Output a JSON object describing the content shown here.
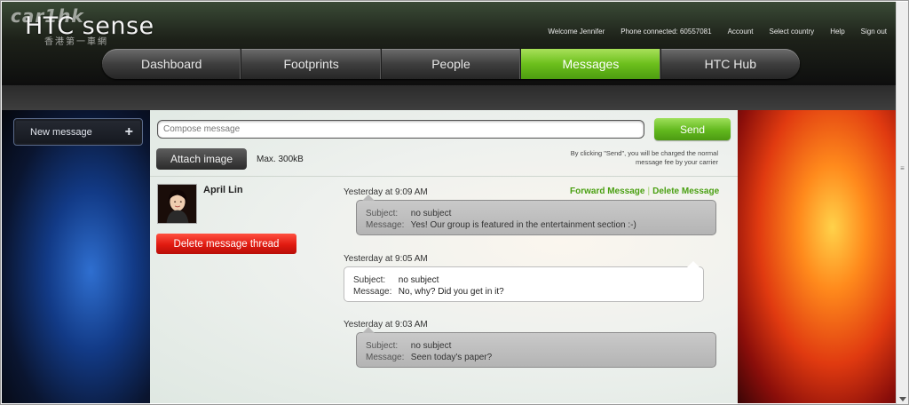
{
  "header": {
    "logo": "HTC sense",
    "watermark": "car1hk",
    "watermark_sub": "香港第一車網",
    "links": {
      "welcome": "Welcome Jennifer",
      "phone": "Phone connected: 60557081",
      "account": "Account",
      "country": "Select country",
      "help": "Help",
      "signout": "Sign out"
    }
  },
  "nav": {
    "tabs": [
      {
        "label": "Dashboard"
      },
      {
        "label": "Footprints"
      },
      {
        "label": "People"
      },
      {
        "label": "Messages"
      },
      {
        "label": "HTC Hub"
      }
    ],
    "active": "Messages"
  },
  "sidebar": {
    "new_message_label": "New message",
    "new_message_icon": "+"
  },
  "compose": {
    "placeholder": "Compose message",
    "send_label": "Send",
    "attach_label": "Attach image",
    "max_size": "Max. 300kB",
    "disclaimer": "By clicking \"Send\", you will be charged the normal message fee by your carrier"
  },
  "contact": {
    "name": "April Lin",
    "delete_thread_label": "Delete message thread"
  },
  "message_actions": {
    "forward": "Forward Message",
    "separator": "|",
    "delete": "Delete Message"
  },
  "labels": {
    "subject": "Subject:",
    "message": "Message:"
  },
  "messages": [
    {
      "time": "Yesterday at 9:09 AM",
      "direction": "in",
      "subject": "no subject",
      "body": "Yes! Our group is featured in the entertainment section :-)"
    },
    {
      "time": "Yesterday at 9:05 AM",
      "direction": "out",
      "subject": "no subject",
      "body": "No, why? Did you get in it?"
    },
    {
      "time": "Yesterday at 9:03 AM",
      "direction": "in",
      "subject": "no subject",
      "body": "Seen today's paper?"
    }
  ],
  "colors": {
    "accent_green": "#6cbf1c",
    "danger_red": "#e01a10",
    "link_green": "#4aa012"
  }
}
